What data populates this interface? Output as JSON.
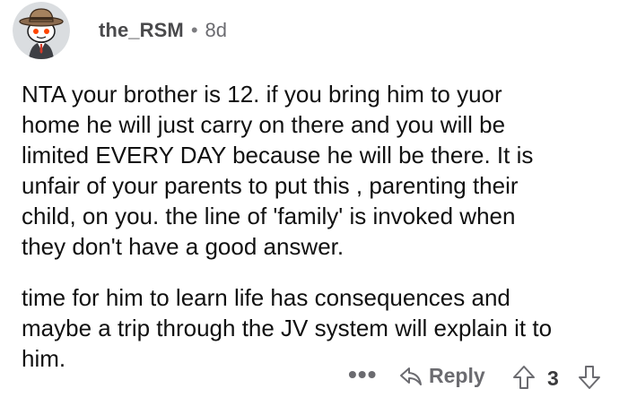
{
  "comment": {
    "author": "the_RSM",
    "separator": "•",
    "age": "8d",
    "avatar_icon": "snoo-cowboy-avatar-icon",
    "paragraphs": [
      "NTA  your brother is 12. if you bring him to yuor\nhome he will just carry on there and you will be\nlimited EVERY DAY because he will be there. It is\nunfair of your parents to put this , parenting their\nchild, on you. the line of 'family' is invoked when\nthey don't have a good answer.",
      "time for him to learn life has consequences and\nmaybe a trip through the JV system will explain it to\nhim."
    ]
  },
  "actions": {
    "more_label": "•••",
    "reply_label": "Reply",
    "reply_icon": "reply-arrow-icon",
    "upvote_icon": "upvote-arrow-icon",
    "score": "3",
    "downvote_icon": "downvote-arrow-icon"
  },
  "colors": {
    "meta_text": "#6b6b70",
    "body_text": "#111111",
    "icon": "#6b6b70"
  }
}
